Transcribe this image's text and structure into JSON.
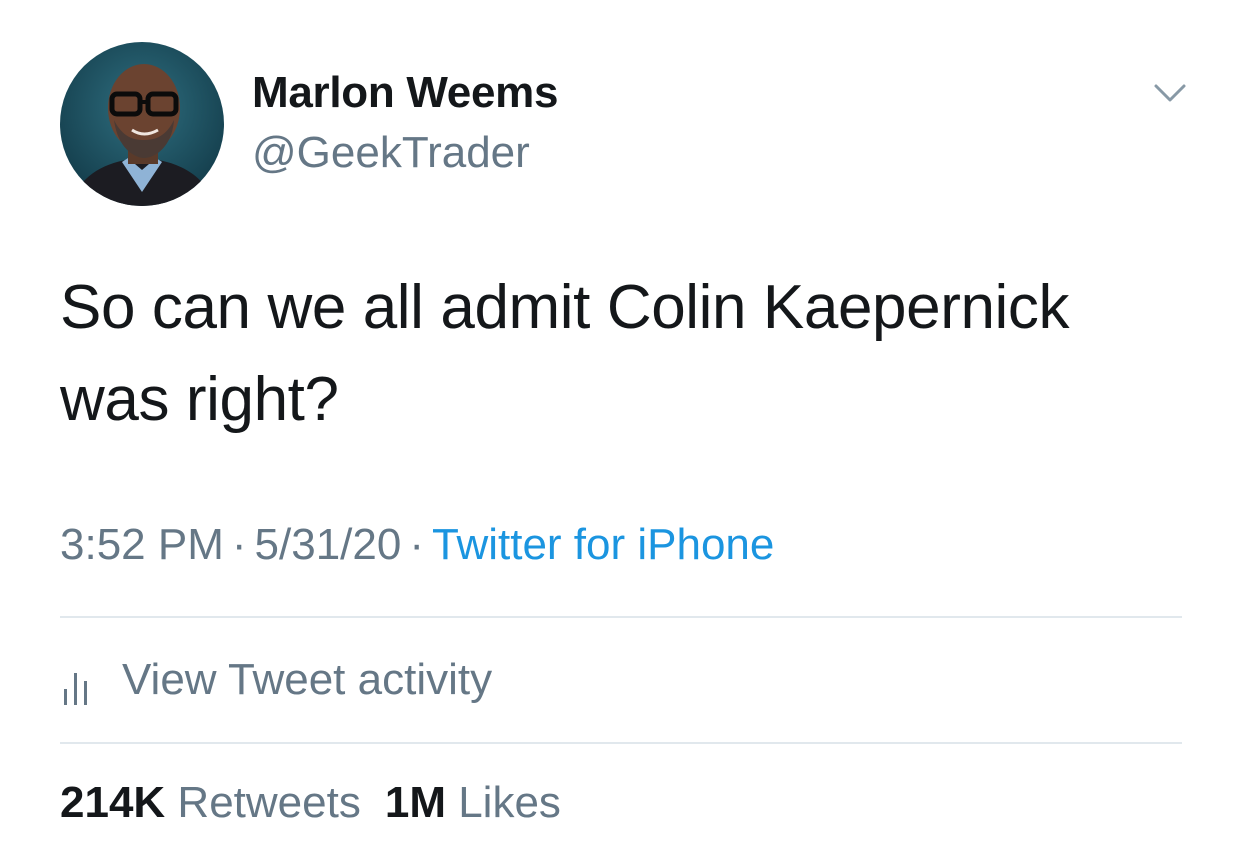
{
  "author": {
    "display_name": "Marlon Weems",
    "handle": "@GeekTrader"
  },
  "tweet": {
    "text_line1": "So can we all admit Colin Kaepernick",
    "text_line2": "was right?",
    "time": "3:52 PM",
    "date": "5/31/20",
    "separator": "·",
    "source": "Twitter for iPhone"
  },
  "activity": {
    "label": "View Tweet activity",
    "icon": "bar-chart-icon"
  },
  "stats": {
    "retweets_count": "214K",
    "retweets_label": "Retweets",
    "likes_count": "1M",
    "likes_label": "Likes"
  },
  "colors": {
    "text_primary": "#14171a",
    "text_secondary": "#657786",
    "link": "#1b95e0",
    "divider": "#e1e8ed"
  }
}
